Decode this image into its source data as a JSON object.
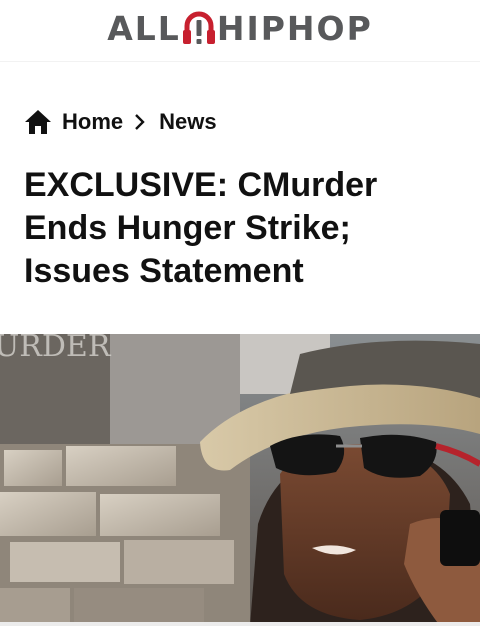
{
  "header": {
    "logo_left": "ALL",
    "logo_right": "HIPHOP",
    "brand_red": "#c7202f",
    "brand_gray": "#58595b"
  },
  "breadcrumb": {
    "home_label": "Home",
    "section_label": "News"
  },
  "article": {
    "title": "EXCLUSIVE: CMurder Ends Hunger Strike; Issues Statement",
    "hero_sign_text": "URDER"
  },
  "icons": {
    "home": "home-icon",
    "separator": "chevron-right-icon",
    "logo_mark": "headphone-exclamation-icon"
  }
}
